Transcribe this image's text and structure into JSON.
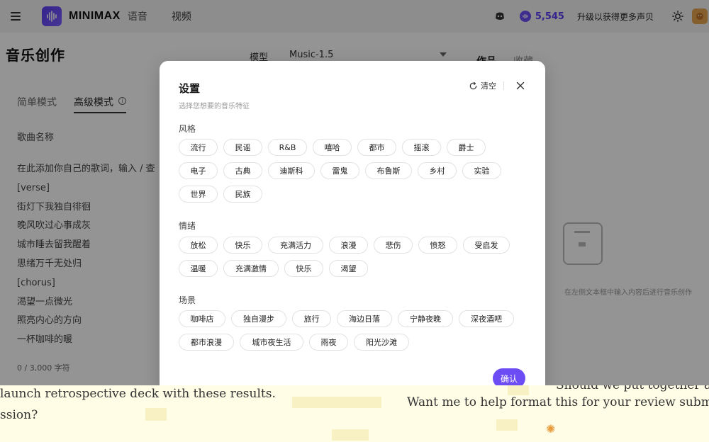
{
  "topbar": {
    "brand": "MINIMAX",
    "nav_voice": "语音",
    "nav_video": "视频",
    "credits": "5,545",
    "upgrade": "升级以获得更多声贝"
  },
  "background": {
    "page_title": "音乐创作",
    "model_label": "模型",
    "model_value": "Music-1.5",
    "tab_works": "作品",
    "tab_fav": "收藏",
    "mode_simple": "简单模式",
    "mode_advanced": "高级模式",
    "song_name_label": "歌曲名称",
    "lyrics": [
      "在此添加你自己的歌词，输入 / 查",
      "[verse]",
      "街灯下我独自徘徊",
      "晚风吹过心事成灰",
      "城市睡去留我醒着",
      "思绪万千无处归",
      "[chorus]",
      "渴望一点微光",
      "照亮内心的方向",
      "一杯咖啡的暖"
    ],
    "char_count": "0 / 3,000 字符",
    "empty_text": "在左侧文本框中输入内容后进行音乐创作"
  },
  "modal": {
    "title": "设置",
    "subtitle": "选择您想要的音乐特征",
    "clear": "清空",
    "confirm": "确认",
    "sections": [
      {
        "label": "风格",
        "rows": [
          [
            "流行",
            "民谣",
            "R&B",
            "嘻哈",
            "都市",
            "摇滚",
            "爵士"
          ],
          [
            "电子",
            "古典",
            "迪斯科",
            "雷鬼",
            "布鲁斯",
            "乡村",
            "实验"
          ],
          [
            "世界",
            "民族"
          ]
        ]
      },
      {
        "label": "情绪",
        "rows": [
          [
            "放松",
            "快乐",
            "充满活力",
            "浪漫",
            "悲伤",
            "愤怒",
            "受启发"
          ],
          [
            "温暖",
            "充满激情",
            "快乐",
            "渴望"
          ]
        ]
      },
      {
        "label": "场景",
        "rows": [
          [
            "咖啡店",
            "独自漫步",
            "旅行",
            "海边日落",
            "宁静夜晚",
            "深夜酒吧"
          ],
          [
            "都市浪漫",
            "城市夜生活",
            "雨夜",
            "阳光沙滩"
          ]
        ]
      }
    ]
  },
  "bottom": {
    "line1": "launch retrospective deck with these results.",
    "line2": "ssion?",
    "line3": "Should we put together a",
    "line4": "Want me to help format this for your review submi"
  }
}
